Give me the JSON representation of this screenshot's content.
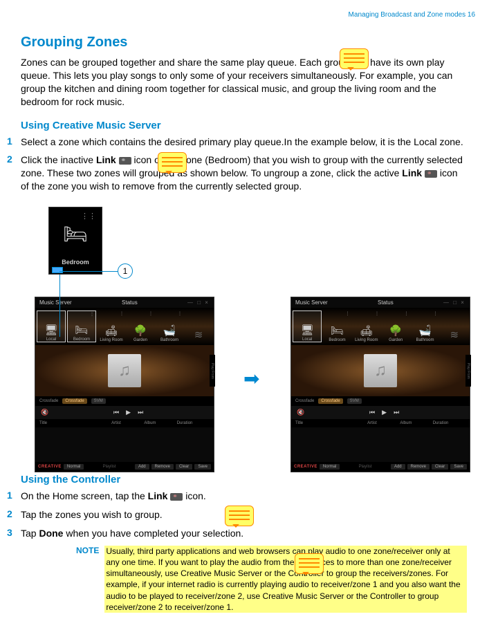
{
  "header": {
    "breadcrumb": "Managing Broadcast and Zone modes  16"
  },
  "h2": "Grouping Zones",
  "p1": "Zones can be grouped together and share the same play queue. Each group can have its own play queue. This lets you play songs to only some of your receivers simultaneously. For example, you can group the kitchen and dining room together for classical music, and group the living room and the bedroom for rock music.",
  "h3a": "Using Creative Music Server",
  "stepsA": {
    "s1n": "1",
    "s1t": "Select a zone which contains the desired primary play queue.In the example below, it is the Local zone.",
    "s2n": "2",
    "s2t_a": "Click the inactive ",
    "s2t_b": "Link",
    "s2t_c": " icon of the zone (Bedroom) that you wish to group with the currently selected zone. These two zones will grouped as shown below. To ungroup a zone, click the active ",
    "s2t_d": "Link",
    "s2t_e": " icon of the zone you wish to remove from the currently selected group."
  },
  "callout": "1",
  "zoomTile": {
    "label": "Bedroom"
  },
  "app": {
    "title": "Music Server",
    "status": "Status",
    "zones": [
      "Local",
      "Bedroom",
      "Living Room",
      "Garden",
      "Bathroom"
    ],
    "sidebar": "Play From",
    "crossfade": "Crossfade",
    "cfOn": "Crossfade",
    "svm": "SVM",
    "cols": [
      "Title",
      "Artist",
      "Album",
      "Duration"
    ],
    "playlist": "Playlist",
    "brand": "CREATIVE",
    "sel": "Normal",
    "btns": [
      "Add",
      "Remove",
      "Clear",
      "Save"
    ]
  },
  "h3b": "Using the Controller",
  "stepsB": {
    "s1n": "1",
    "s1t_a": "On the Home screen, tap the ",
    "s1t_b": "Link",
    "s1t_c": " icon.",
    "s2n": "2",
    "s2t": "Tap the zones you wish to group.",
    "s3n": "3",
    "s3t_a": "Tap ",
    "s3t_b": "Done",
    "s3t_c": " when you have completed your selection."
  },
  "note": {
    "label": "NOTE",
    "text": "Usually, third party applications and web browsers can play audio to one zone/receiver only at any one time. If you want to play the audio from these sources to more than one zone/receiver simultaneously, use Creative Music Server or the Controller to group the receivers/zones. For example, if your internet radio is currently playing audio to receiver/zone 1 and you also want the audio to be played to receiver/zone 2, use Creative Music Server or the Controller to group receiver/zone 2 to receiver/zone 1."
  }
}
